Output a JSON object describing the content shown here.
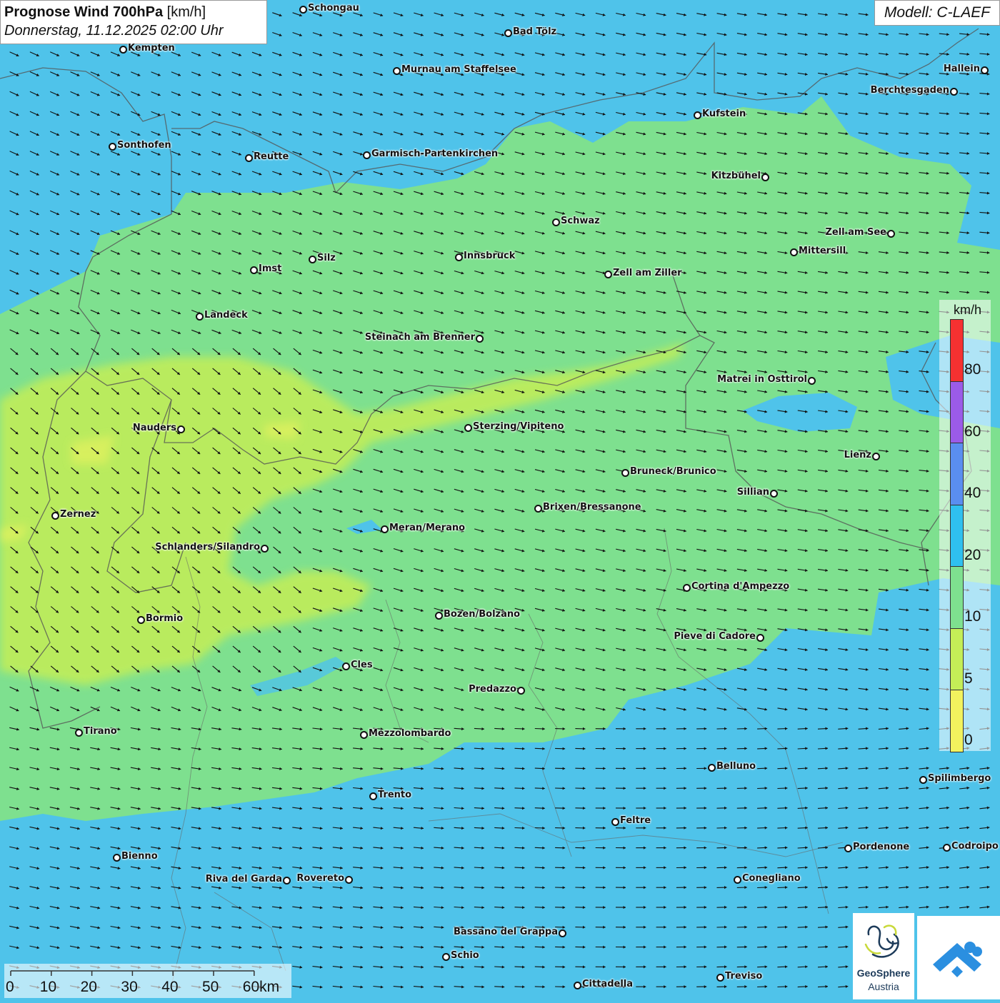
{
  "title": {
    "main": "Prognose Wind 700hPa",
    "unit": "[km/h]",
    "datetime": "Donnerstag, 11.12.2025 02:00 Uhr"
  },
  "model": "Modell: C-LAEF",
  "legend": {
    "unit": "km/h",
    "labels": [
      "80",
      "60",
      "40",
      "20",
      "10",
      "5",
      "0"
    ],
    "colors": [
      "#f53131",
      "#9b5be8",
      "#5a8ef0",
      "#2fc0ef",
      "#7ee08f",
      "#c4ee57",
      "#f2f25e"
    ]
  },
  "scale": {
    "labels": [
      "0",
      "10",
      "20",
      "30",
      "40",
      "50",
      "60km"
    ]
  },
  "logo": {
    "line1": "GeoSphere",
    "line2": "Austria"
  },
  "cities": [
    {
      "name": "Schongau"
    },
    {
      "name": "Bad Tölz"
    },
    {
      "name": "Kempten"
    },
    {
      "name": "Murnau am Staffelsee"
    },
    {
      "name": "Hallein"
    },
    {
      "name": "Berchtesgaden"
    },
    {
      "name": "Kufstein"
    },
    {
      "name": "Sonthofen"
    },
    {
      "name": "Reutte"
    },
    {
      "name": "Garmisch-Partenkirchen"
    },
    {
      "name": "Kitzbühel"
    },
    {
      "name": "Schwaz"
    },
    {
      "name": "Zell am See"
    },
    {
      "name": "Innsbruck"
    },
    {
      "name": "Silz"
    },
    {
      "name": "Mittersill"
    },
    {
      "name": "Imst"
    },
    {
      "name": "Zell am Ziller"
    },
    {
      "name": "Landeck"
    },
    {
      "name": "Steinach am Brenner"
    },
    {
      "name": "Matrei in Osttirol"
    },
    {
      "name": "Nauders"
    },
    {
      "name": "Sterzing/Vipiteno"
    },
    {
      "name": "Lienz"
    },
    {
      "name": "Bruneck/Brunico"
    },
    {
      "name": "Sillian"
    },
    {
      "name": "Brixen/Bressanone"
    },
    {
      "name": "Zernez"
    },
    {
      "name": "Meran/Merano"
    },
    {
      "name": "Schlanders/Silandro"
    },
    {
      "name": "Cortina d'Ampezzo"
    },
    {
      "name": "Bozen/Bolzano"
    },
    {
      "name": "Bormio"
    },
    {
      "name": "Pieve di Cadore"
    },
    {
      "name": "Cles"
    },
    {
      "name": "Predazzo"
    },
    {
      "name": "Tirano"
    },
    {
      "name": "Mezzolombardo"
    },
    {
      "name": "Belluno"
    },
    {
      "name": "Spilimbergo"
    },
    {
      "name": "Trento"
    },
    {
      "name": "Feltre"
    },
    {
      "name": "Pordenone"
    },
    {
      "name": "Codroipo"
    },
    {
      "name": "Bienno"
    },
    {
      "name": "Riva del Garda"
    },
    {
      "name": "Rovereto"
    },
    {
      "name": "Conegliano"
    },
    {
      "name": "Bassano del Grappa"
    },
    {
      "name": "Schio"
    },
    {
      "name": "Treviso"
    },
    {
      "name": "Cittadella"
    }
  ]
}
